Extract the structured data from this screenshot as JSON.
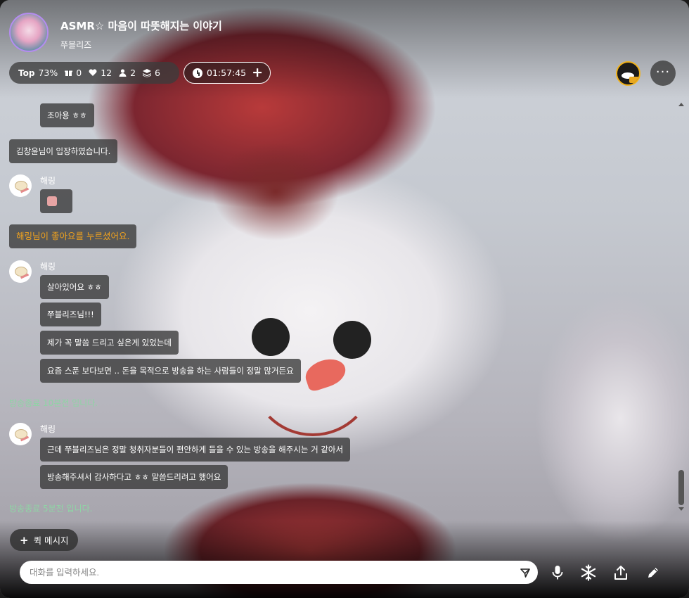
{
  "header": {
    "title": "ASMR☆ 마음이 따뜻해지는 이야기",
    "host_name": "쭈블리즈",
    "host_avatar_icon": "host-avatar-image",
    "stats": {
      "rank_label": "Top",
      "rank_value": "73%",
      "gifts": "0",
      "likes": "12",
      "listeners": "2",
      "layers": "6"
    },
    "timer": "01:57:45",
    "more_label": "···"
  },
  "chat": {
    "messages": [
      {
        "type": "bubble",
        "text": "조아용 ㅎㅎ"
      },
      {
        "type": "system",
        "text": "김창윤님이 입장하였습니다."
      },
      {
        "type": "user",
        "name": "해링"
      },
      {
        "type": "like",
        "text": "해링님이 좋아요를 누르셨어요."
      },
      {
        "type": "user",
        "name": "해링"
      },
      {
        "type": "bubble",
        "text": "살아있어요 ㅎㅎ"
      },
      {
        "type": "bubble",
        "text": "쭈블리즈님!!!"
      },
      {
        "type": "bubble",
        "text": "제가 꼭 말씀 드리고 싶은게 있었는데"
      },
      {
        "type": "bubble",
        "text": "요즘 스푼 보다보면 .. 돈을 목적으로 방송을 하는 사람들이 정말 많거든요"
      },
      {
        "type": "notice",
        "text": "방송종료 10분전 입니다."
      },
      {
        "type": "user",
        "name": "해링"
      },
      {
        "type": "bubble",
        "text": "근데 쭈블리즈님은 정말 청취자분들이 편안하게 들을 수 있는 방송을 해주시는 거 같아서"
      },
      {
        "type": "bubble",
        "text": "방송해주셔서 감사하다고 ㅎㅎ 말씀드리려고 했어요"
      },
      {
        "type": "notice",
        "text": "방송종료 5분전 입니다."
      }
    ],
    "colors": {
      "like": "#f0a21e",
      "notice": "#8fd4a5"
    }
  },
  "quick_message": {
    "label": "퀵 메시지"
  },
  "input": {
    "placeholder": "대화를 입력하세요."
  },
  "toolbar": {
    "icons": [
      "send-icon",
      "microphone-icon",
      "snowflake-icon",
      "share-icon",
      "pencil-icon"
    ]
  }
}
